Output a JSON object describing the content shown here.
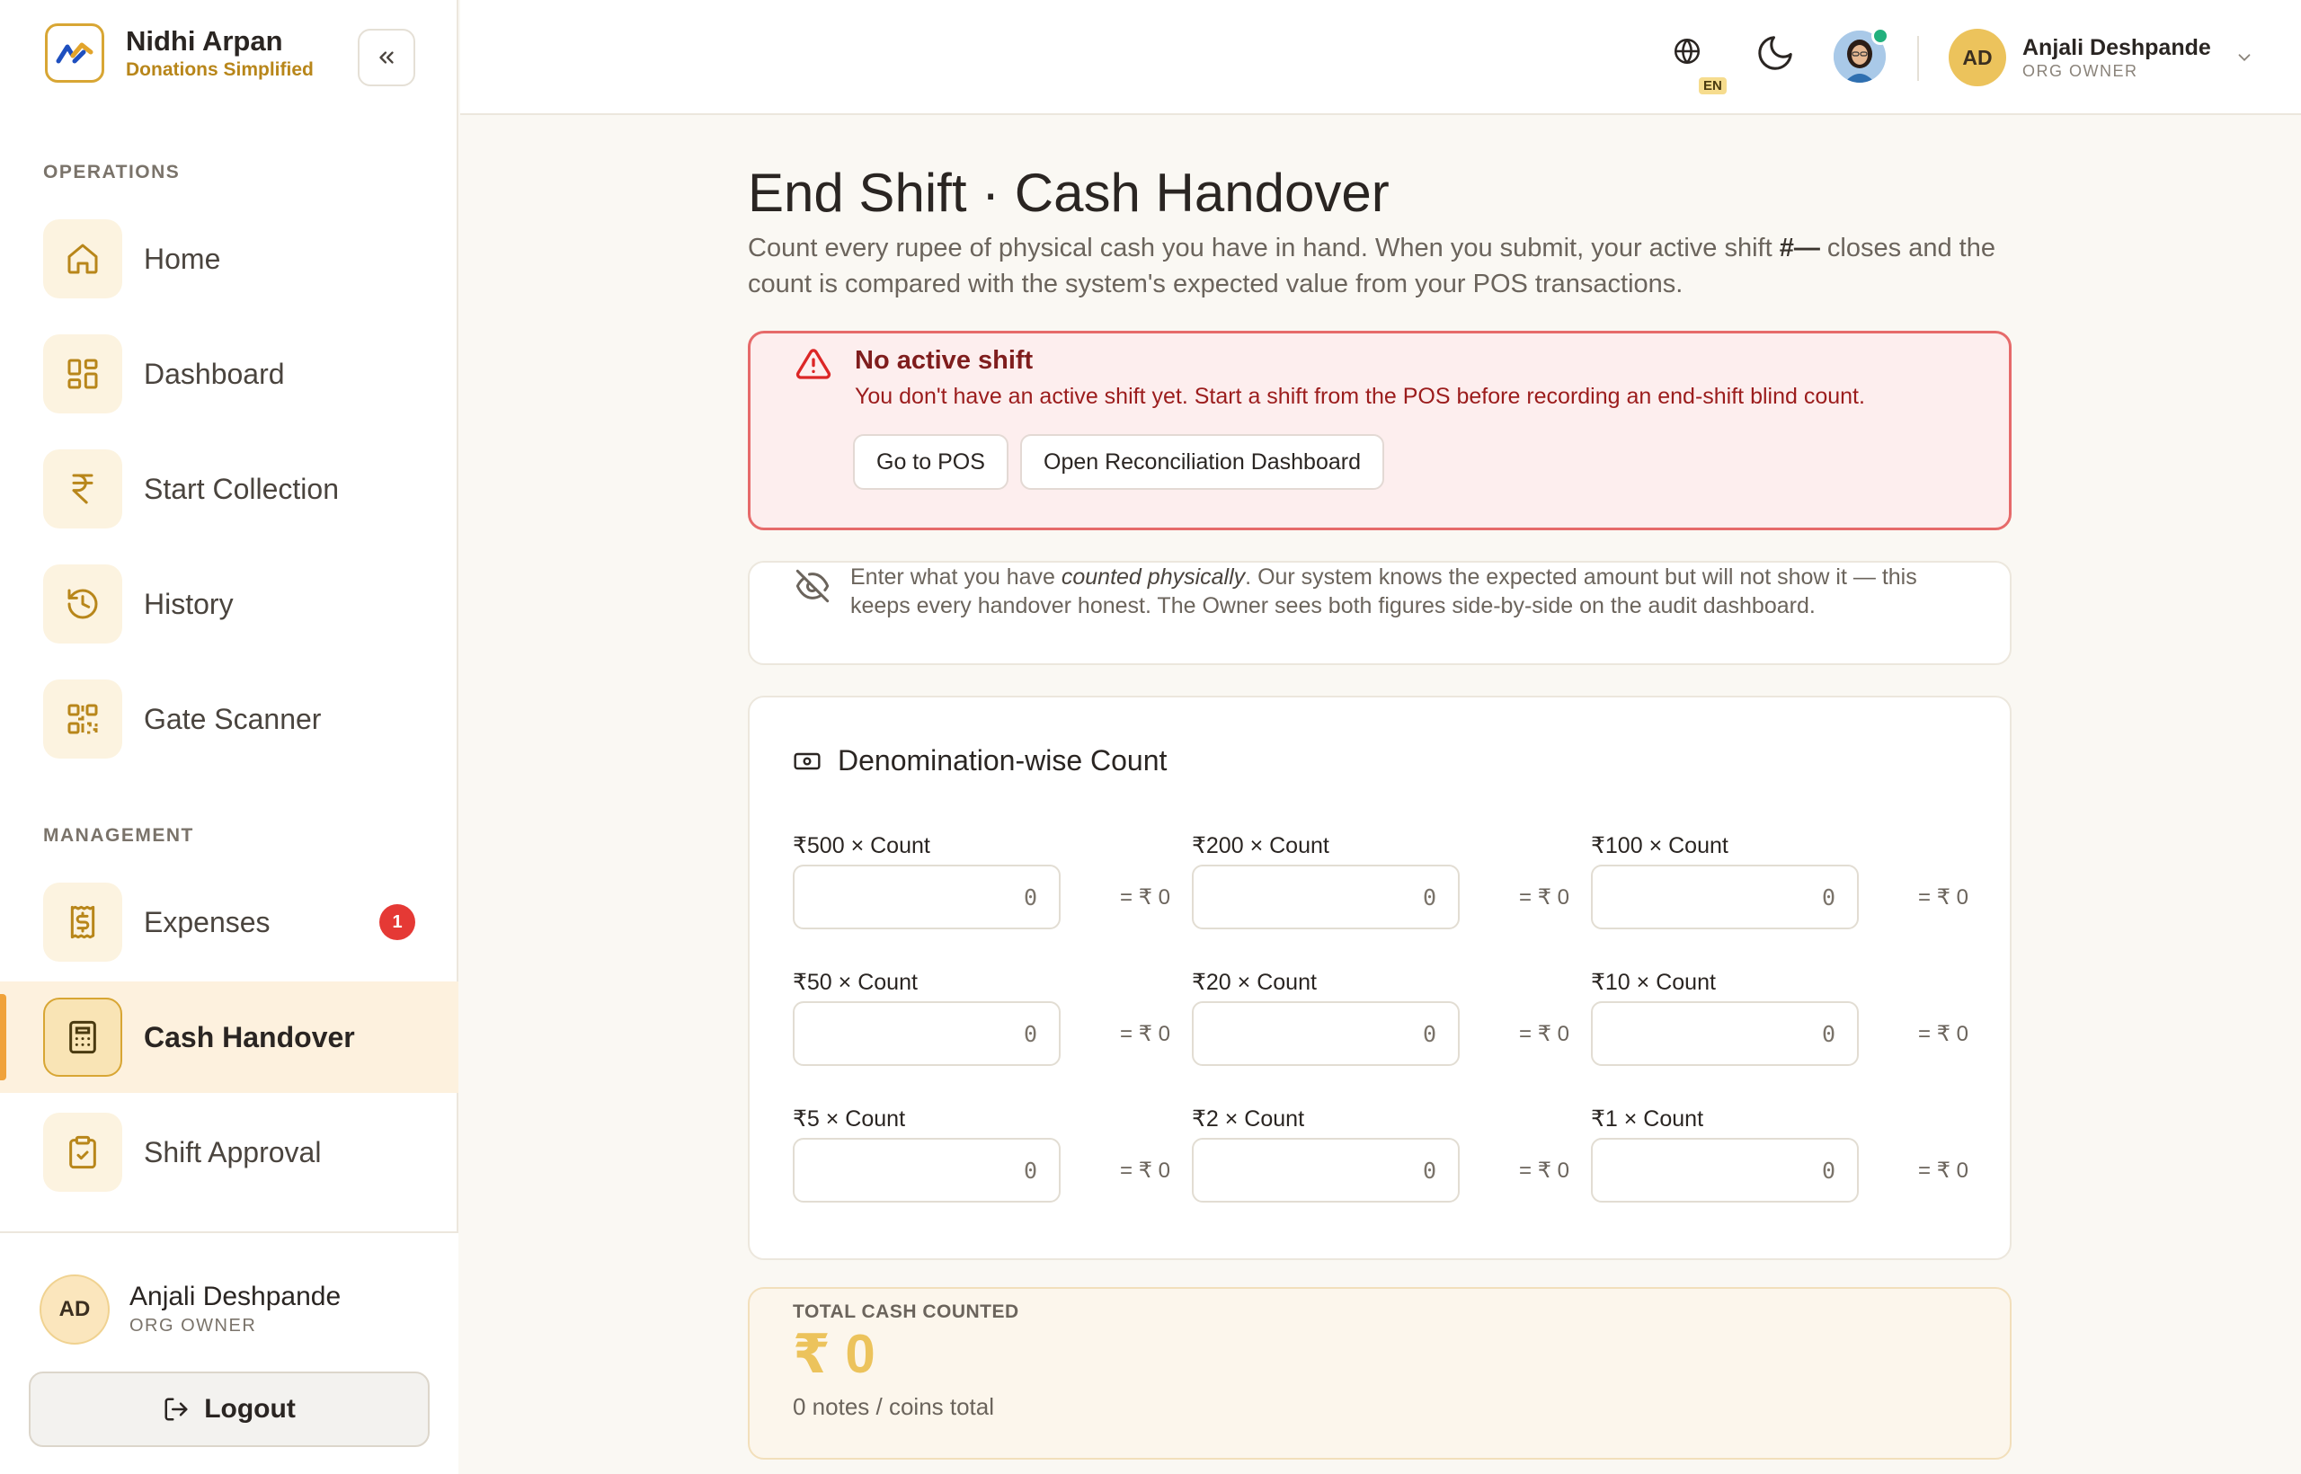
{
  "brand": {
    "name": "Nidhi Arpan",
    "tagline": "Donations Simplified"
  },
  "sidebar": {
    "sections": {
      "operations": "OPERATIONS",
      "management": "MANAGEMENT"
    },
    "operations": [
      {
        "label": "Home",
        "icon": "home-icon"
      },
      {
        "label": "Dashboard",
        "icon": "dashboard-icon"
      },
      {
        "label": "Start Collection",
        "icon": "rupee-icon"
      },
      {
        "label": "History",
        "icon": "history-icon"
      },
      {
        "label": "Gate Scanner",
        "icon": "qr-icon"
      }
    ],
    "management": [
      {
        "label": "Expenses",
        "icon": "receipt-icon",
        "badge": "1"
      },
      {
        "label": "Cash Handover",
        "icon": "calculator-icon",
        "active": true
      },
      {
        "label": "Shift Approval",
        "icon": "clipboard-check-icon"
      }
    ],
    "footer": {
      "user_name": "Anjali Deshpande",
      "user_role": "ORG OWNER",
      "initials": "AD",
      "logout": "Logout"
    }
  },
  "topbar": {
    "language": "EN",
    "user_name": "Anjali Deshpande",
    "user_role": "ORG OWNER",
    "initials": "AD"
  },
  "page": {
    "title": "End Shift · Cash Handover",
    "subtitle_pre": "Count every rupee of physical cash you have in hand. When you submit, your active shift ",
    "subtitle_shift": "#—",
    "subtitle_post": " closes and the count is compared with the system's expected value from your POS transactions."
  },
  "alert": {
    "title": "No active shift",
    "text": "You don't have an active shift yet. Start a shift from the POS before recording an end-shift blind count.",
    "button_pos": "Go to POS",
    "button_dashboard": "Open Reconciliation Dashboard"
  },
  "note": {
    "pre": "Enter what you have ",
    "emph": "counted physically",
    "post": ". Our system knows the expected amount but will not show it — this keeps every handover honest. The Owner sees both figures side-by-side on the audit dashboard."
  },
  "denominations": {
    "title": "Denomination-wise Count",
    "items": [
      {
        "label": "₹500 × Count",
        "value": "0",
        "subtotal": "= ₹ 0"
      },
      {
        "label": "₹200 × Count",
        "value": "0",
        "subtotal": "= ₹ 0"
      },
      {
        "label": "₹100 × Count",
        "value": "0",
        "subtotal": "= ₹ 0"
      },
      {
        "label": "₹50 × Count",
        "value": "0",
        "subtotal": "= ₹ 0"
      },
      {
        "label": "₹20 × Count",
        "value": "0",
        "subtotal": "= ₹ 0"
      },
      {
        "label": "₹10 × Count",
        "value": "0",
        "subtotal": "= ₹ 0"
      },
      {
        "label": "₹5 × Count",
        "value": "0",
        "subtotal": "= ₹ 0"
      },
      {
        "label": "₹2 × Count",
        "value": "0",
        "subtotal": "= ₹ 0"
      },
      {
        "label": "₹1 × Count",
        "value": "0",
        "subtotal": "= ₹ 0"
      }
    ]
  },
  "total": {
    "label": "TOTAL CASH COUNTED",
    "value": "₹ 0",
    "sub": "0 notes / coins total"
  },
  "colors": {
    "accent": "#d8a634",
    "danger": "#e66a6a",
    "badge": "#e53935",
    "online": "#22b07d"
  }
}
